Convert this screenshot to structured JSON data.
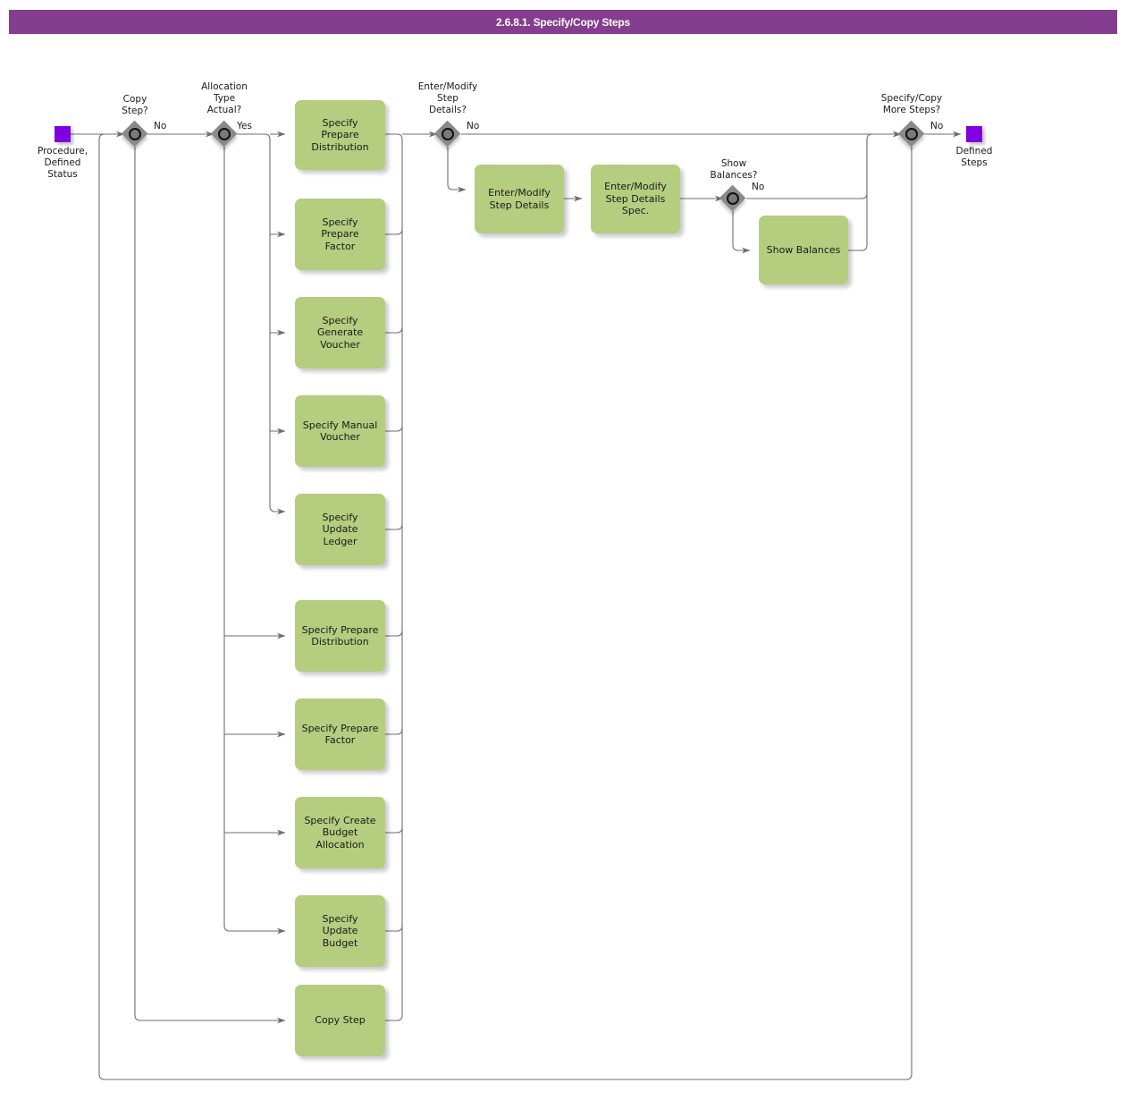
{
  "title": "2.6.8.1. Specify/Copy Steps",
  "colors": {
    "title_bar": "#853d8f",
    "task_fill": "#b5cd7f",
    "event_fill": "#8000e0",
    "gateway_fill": "#8a8a8a",
    "edge": "#6e6e6e"
  },
  "events": [
    {
      "id": "start",
      "label": "Procedure,\nDefined\nStatus"
    },
    {
      "id": "end",
      "label": "Defined\nSteps"
    }
  ],
  "gateways": [
    {
      "id": "gw_copy_step",
      "label": "Copy\nStep?",
      "branch_label": "No"
    },
    {
      "id": "gw_alloc_type",
      "label": "Allocation\nType\nActual?",
      "branch_label": "Yes"
    },
    {
      "id": "gw_step_details",
      "label": "Enter/Modify\nStep\nDetails?",
      "branch_label": "No"
    },
    {
      "id": "gw_show_bal",
      "label": "Show\nBalances?",
      "branch_label": "No"
    },
    {
      "id": "gw_more_steps",
      "label": "Specify/Copy\nMore Steps?",
      "branch_label": "No"
    }
  ],
  "tasks": [
    {
      "id": "t1",
      "label": "Specify\nPrepare\nDistribution"
    },
    {
      "id": "t2",
      "label": "Specify\nPrepare\nFactor"
    },
    {
      "id": "t3",
      "label": "Specify\nGenerate\nVoucher"
    },
    {
      "id": "t4",
      "label": "Specify Manual\nVoucher"
    },
    {
      "id": "t5",
      "label": "Specify\nUpdate\nLedger"
    },
    {
      "id": "t6",
      "label": "Specify Prepare\nDistribution"
    },
    {
      "id": "t7",
      "label": "Specify Prepare\nFactor"
    },
    {
      "id": "t8",
      "label": "Specify Create\nBudget\nAllocation"
    },
    {
      "id": "t9",
      "label": "Specify\nUpdate\nBudget"
    },
    {
      "id": "t10",
      "label": "Copy Step"
    },
    {
      "id": "t11",
      "label": "Enter/Modify\nStep Details"
    },
    {
      "id": "t12",
      "label": "Enter/Modify\nStep Details\nSpec."
    },
    {
      "id": "t13",
      "label": "Show Balances"
    }
  ]
}
